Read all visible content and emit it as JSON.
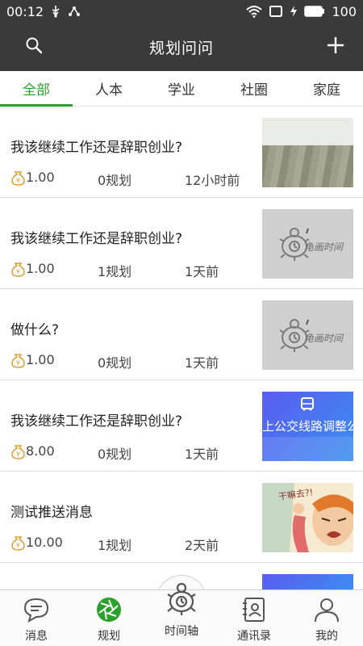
{
  "status": {
    "time": "00:12",
    "battery": "100"
  },
  "appbar": {
    "title": "规划问问"
  },
  "tabs": [
    "全部",
    "人本",
    "学业",
    "社圈",
    "家庭"
  ],
  "items": [
    {
      "question": "我该继续工作还是辞职创业?",
      "price": "1.00",
      "plans": "0规划",
      "time": "12小时前",
      "thumb": "room-photo"
    },
    {
      "question": "我该继续工作还是辞职创业?",
      "price": "1.00",
      "plans": "1规划",
      "time": "1天前",
      "thumb": "turtle-placeholder"
    },
    {
      "question": "做什么?",
      "price": "1.00",
      "plans": "0规划",
      "time": "1天前",
      "thumb": "turtle-placeholder"
    },
    {
      "question": "我该继续工作还是辞职创业?",
      "price": "8.00",
      "plans": "0规划",
      "time": "1天前",
      "thumb": "bus-banner"
    },
    {
      "question": "测试推送消息",
      "price": "10.00",
      "plans": "1规划",
      "time": "2天前",
      "thumb": "comic"
    }
  ],
  "thumb_texts": {
    "placeholder_brand": "龟画时间",
    "bus_banner": "上公交线路调整公",
    "comic_caption": "干嘛去?!"
  },
  "tabbar": [
    {
      "label": "消息",
      "icon": "message-icon"
    },
    {
      "label": "规划",
      "icon": "plan-aperture-icon"
    },
    {
      "label": "时间轴",
      "icon": "turtle-clock-icon"
    },
    {
      "label": "通讯录",
      "icon": "contacts-icon"
    },
    {
      "label": "我的",
      "icon": "profile-icon"
    }
  ],
  "colors": {
    "appbar": "#3a3a3a",
    "accent": "#2aa12a",
    "coin": "#d9a43a"
  }
}
